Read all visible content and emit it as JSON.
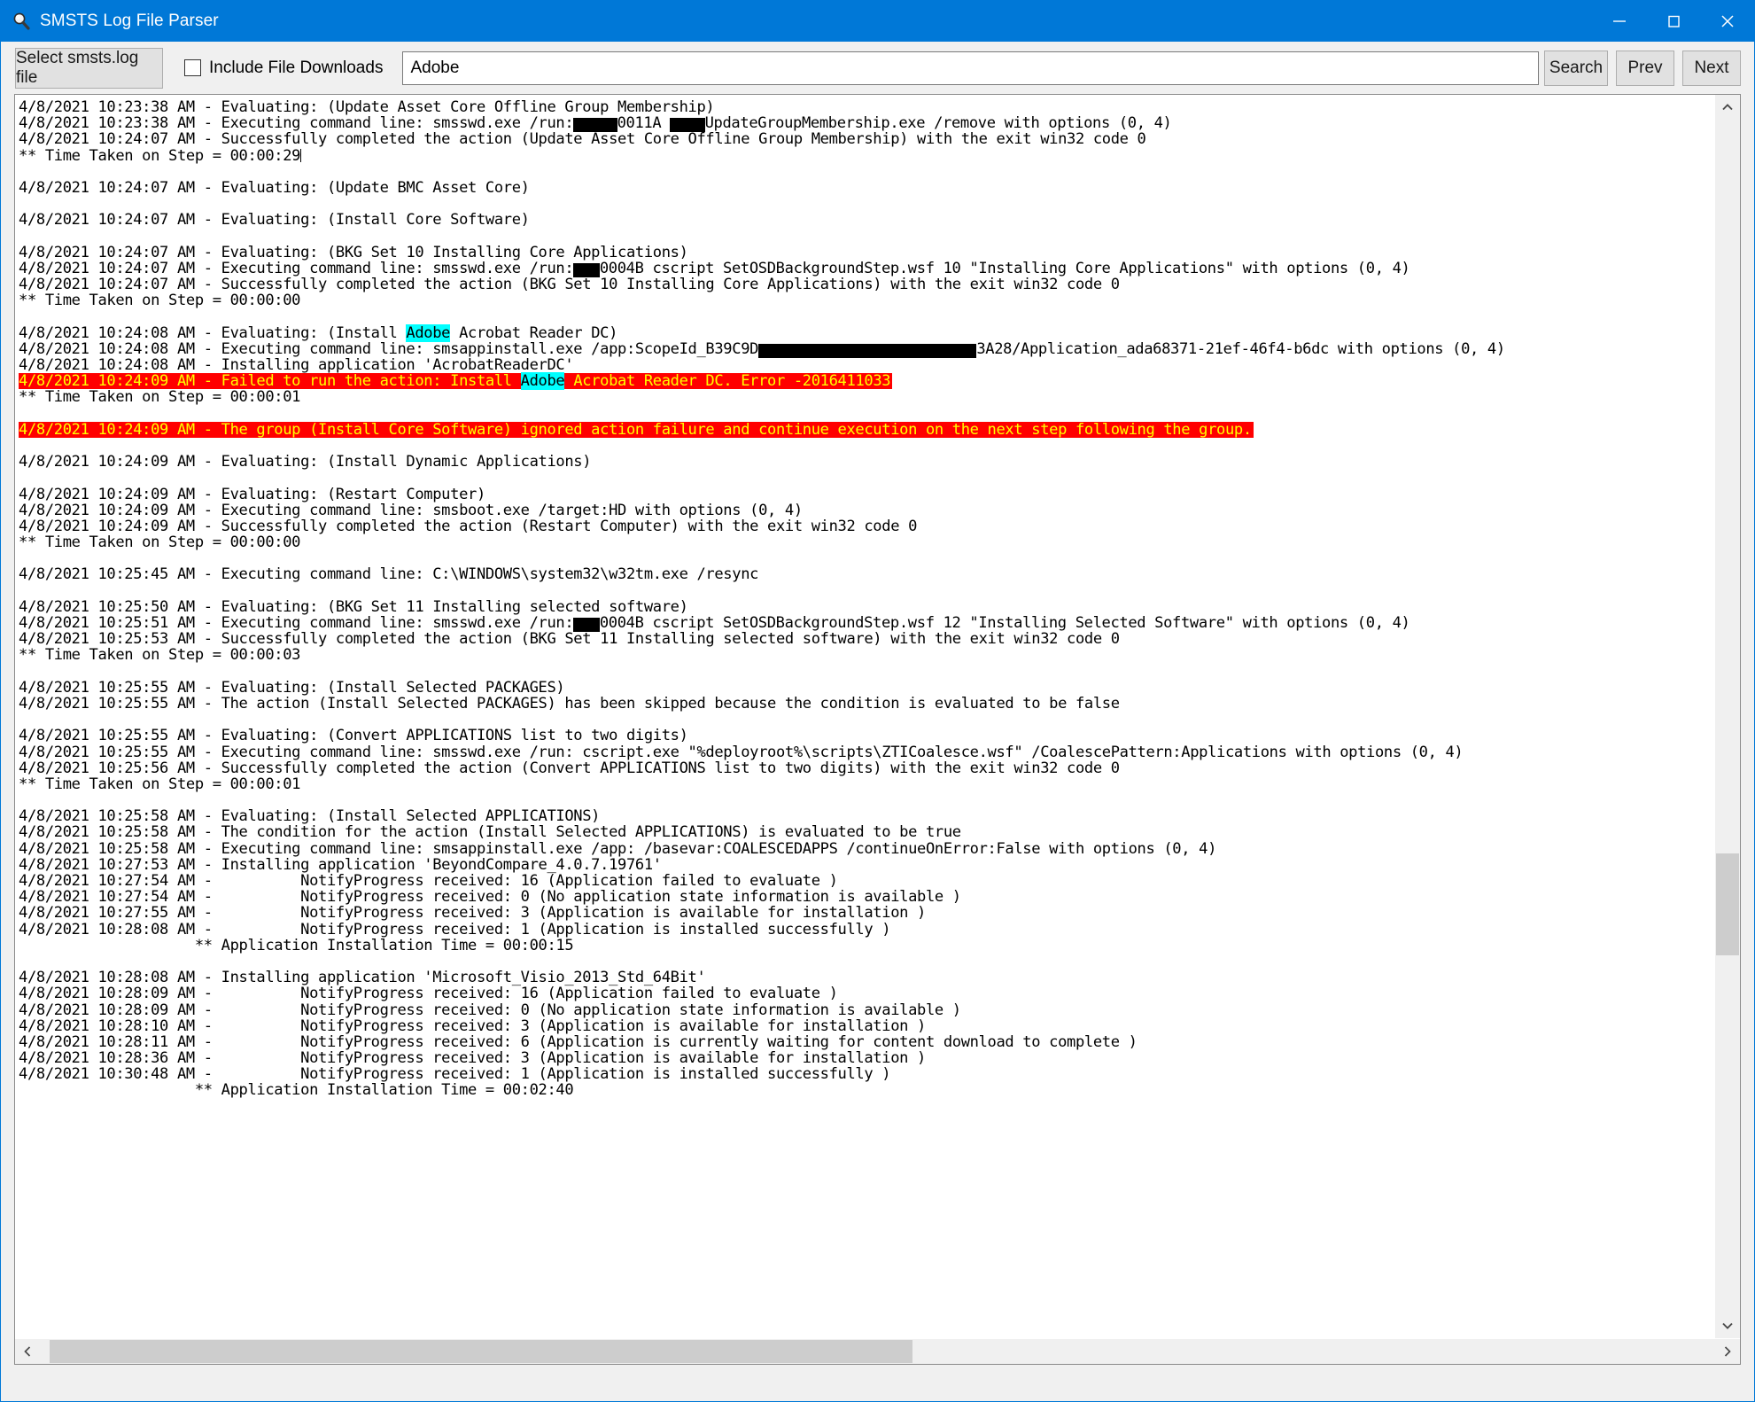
{
  "window": {
    "title": "SMSTS Log File Parser",
    "title_icon": "magnifier-icon",
    "accent_color": "#0078d7",
    "minimize_label": "─",
    "maximize_label": "☐",
    "close_label": "✕"
  },
  "toolbar": {
    "select_log_label": "Select smsts.log file",
    "include_downloads_label": "Include File Downloads",
    "include_downloads_checked": false,
    "search_value": "Adobe",
    "search_placeholder": "",
    "search_label": "Search",
    "prev_label": "Prev",
    "next_label": "Next"
  },
  "highlight": {
    "term": "Adobe",
    "color": "#00ffff",
    "error_bg": "#ff0000",
    "error_fg": "#ffff00"
  },
  "scrollbars": {
    "vertical": {
      "thumb_top_pct": 61.5,
      "thumb_height_pct": 8.5,
      "up_arrow": "⌃",
      "down_arrow": "⌄"
    },
    "horizontal": {
      "thumb_left_pct": 0.6,
      "thumb_width_pct": 51.5,
      "left_arrow": "‹",
      "right_arrow": "›"
    }
  },
  "log": {
    "lines": [
      {
        "t": "4/8/2021 10:23:38 AM - Evaluating: (Update Asset Core Offline Group Membership)"
      },
      {
        "segments": [
          {
            "text": "4/8/2021 10:23:38 AM - Executing command line: smsswd.exe /run:"
          },
          {
            "redact": 5
          },
          {
            "text": "0011A "
          },
          {
            "redact": 4
          },
          {
            "text": "UpdateGroupMembership.exe /remove with options (0, 4)"
          }
        ]
      },
      {
        "t": "4/8/2021 10:24:07 AM - Successfully completed the action (Update Asset Core Offline Group Membership) with the exit win32 code 0"
      },
      {
        "t": "** Time Taken on Step = 00:00:29",
        "caret": true
      },
      {
        "t": ""
      },
      {
        "t": "4/8/2021 10:24:07 AM - Evaluating: (Update BMC Asset Core)"
      },
      {
        "t": ""
      },
      {
        "t": "4/8/2021 10:24:07 AM - Evaluating: (Install Core Software)"
      },
      {
        "t": ""
      },
      {
        "t": "4/8/2021 10:24:07 AM - Evaluating: (BKG Set 10 Installing Core Applications)"
      },
      {
        "segments": [
          {
            "text": "4/8/2021 10:24:07 AM - Executing command line: smsswd.exe /run:"
          },
          {
            "redact": 3
          },
          {
            "text": "0004B cscript SetOSDBackgroundStep.wsf 10 \"Installing Core Applications\" with options (0, 4)"
          }
        ]
      },
      {
        "t": "4/8/2021 10:24:07 AM - Successfully completed the action (BKG Set 10 Installing Core Applications) with the exit win32 code 0"
      },
      {
        "t": "** Time Taken on Step = 00:00:00"
      },
      {
        "t": ""
      },
      {
        "t": "4/8/2021 10:24:08 AM - Evaluating: (Install Adobe Acrobat Reader DC)",
        "hl": "Adobe"
      },
      {
        "segments": [
          {
            "text": "4/8/2021 10:24:08 AM - Executing command line: smsappinstall.exe /app:ScopeId_B39C9D"
          },
          {
            "redact": 25
          },
          {
            "text": "3A28/Application_ada68371-21ef-46f4-b6dc with options (0, 4)"
          }
        ]
      },
      {
        "t": "4/8/2021 10:24:08 AM - Installing application 'AcrobatReaderDC'"
      },
      {
        "t": "4/8/2021 10:24:09 AM - Failed to run the action: Install Adobe Acrobat Reader DC. Error -2016411033",
        "err": true,
        "hl": "Adobe"
      },
      {
        "t": "** Time Taken on Step = 00:00:01"
      },
      {
        "t": ""
      },
      {
        "t": "4/8/2021 10:24:09 AM - The group (Install Core Software) ignored action failure and continue execution on the next step following the group.",
        "err": true
      },
      {
        "t": ""
      },
      {
        "t": "4/8/2021 10:24:09 AM - Evaluating: (Install Dynamic Applications)"
      },
      {
        "t": ""
      },
      {
        "t": "4/8/2021 10:24:09 AM - Evaluating: (Restart Computer)"
      },
      {
        "t": "4/8/2021 10:24:09 AM - Executing command line: smsboot.exe /target:HD with options (0, 4)"
      },
      {
        "t": "4/8/2021 10:24:09 AM - Successfully completed the action (Restart Computer) with the exit win32 code 0"
      },
      {
        "t": "** Time Taken on Step = 00:00:00"
      },
      {
        "t": ""
      },
      {
        "t": "4/8/2021 10:25:45 AM - Executing command line: C:\\WINDOWS\\system32\\w32tm.exe /resync"
      },
      {
        "t": ""
      },
      {
        "t": "4/8/2021 10:25:50 AM - Evaluating: (BKG Set 11 Installing selected software)"
      },
      {
        "segments": [
          {
            "text": "4/8/2021 10:25:51 AM - Executing command line: smsswd.exe /run:"
          },
          {
            "redact": 3
          },
          {
            "text": "0004B cscript SetOSDBackgroundStep.wsf 12 \"Installing Selected Software\" with options (0, 4)"
          }
        ]
      },
      {
        "t": "4/8/2021 10:25:53 AM - Successfully completed the action (BKG Set 11 Installing selected software) with the exit win32 code 0"
      },
      {
        "t": "** Time Taken on Step = 00:00:03"
      },
      {
        "t": ""
      },
      {
        "t": "4/8/2021 10:25:55 AM - Evaluating: (Install Selected PACKAGES)"
      },
      {
        "t": "4/8/2021 10:25:55 AM - The action (Install Selected PACKAGES) has been skipped because the condition is evaluated to be false"
      },
      {
        "t": ""
      },
      {
        "t": "4/8/2021 10:25:55 AM - Evaluating: (Convert APPLICATIONS list to two digits)"
      },
      {
        "t": "4/8/2021 10:25:55 AM - Executing command line: smsswd.exe /run: cscript.exe \"%deployroot%\\scripts\\ZTICoalesce.wsf\" /CoalescePattern:Applications with options (0, 4)"
      },
      {
        "t": "4/8/2021 10:25:56 AM - Successfully completed the action (Convert APPLICATIONS list to two digits) with the exit win32 code 0"
      },
      {
        "t": "** Time Taken on Step = 00:00:01"
      },
      {
        "t": ""
      },
      {
        "t": "4/8/2021 10:25:58 AM - Evaluating: (Install Selected APPLICATIONS)"
      },
      {
        "t": "4/8/2021 10:25:58 AM - The condition for the action (Install Selected APPLICATIONS) is evaluated to be true"
      },
      {
        "t": "4/8/2021 10:25:58 AM - Executing command line: smsappinstall.exe /app: /basevar:COALESCEDAPPS /continueOnError:False with options (0, 4)"
      },
      {
        "t": "4/8/2021 10:27:53 AM - Installing application 'BeyondCompare_4.0.7.19761'"
      },
      {
        "t": "4/8/2021 10:27:54 AM -          NotifyProgress received: 16 (Application failed to evaluate )"
      },
      {
        "t": "4/8/2021 10:27:54 AM -          NotifyProgress received: 0 (No application state information is available )"
      },
      {
        "t": "4/8/2021 10:27:55 AM -          NotifyProgress received: 3 (Application is available for installation )"
      },
      {
        "t": "4/8/2021 10:28:08 AM -          NotifyProgress received: 1 (Application is installed successfully )"
      },
      {
        "t": "                    ** Application Installation Time = 00:00:15"
      },
      {
        "t": ""
      },
      {
        "t": "4/8/2021 10:28:08 AM - Installing application 'Microsoft_Visio_2013_Std_64Bit'"
      },
      {
        "t": "4/8/2021 10:28:09 AM -          NotifyProgress received: 16 (Application failed to evaluate )"
      },
      {
        "t": "4/8/2021 10:28:09 AM -          NotifyProgress received: 0 (No application state information is available )"
      },
      {
        "t": "4/8/2021 10:28:10 AM -          NotifyProgress received: 3 (Application is available for installation )"
      },
      {
        "t": "4/8/2021 10:28:11 AM -          NotifyProgress received: 6 (Application is currently waiting for content download to complete )"
      },
      {
        "t": "4/8/2021 10:28:36 AM -          NotifyProgress received: 3 (Application is available for installation )"
      },
      {
        "t": "4/8/2021 10:30:48 AM -          NotifyProgress received: 1 (Application is installed successfully )"
      },
      {
        "t": "                    ** Application Installation Time = 00:02:40"
      },
      {
        "t": ""
      }
    ]
  }
}
